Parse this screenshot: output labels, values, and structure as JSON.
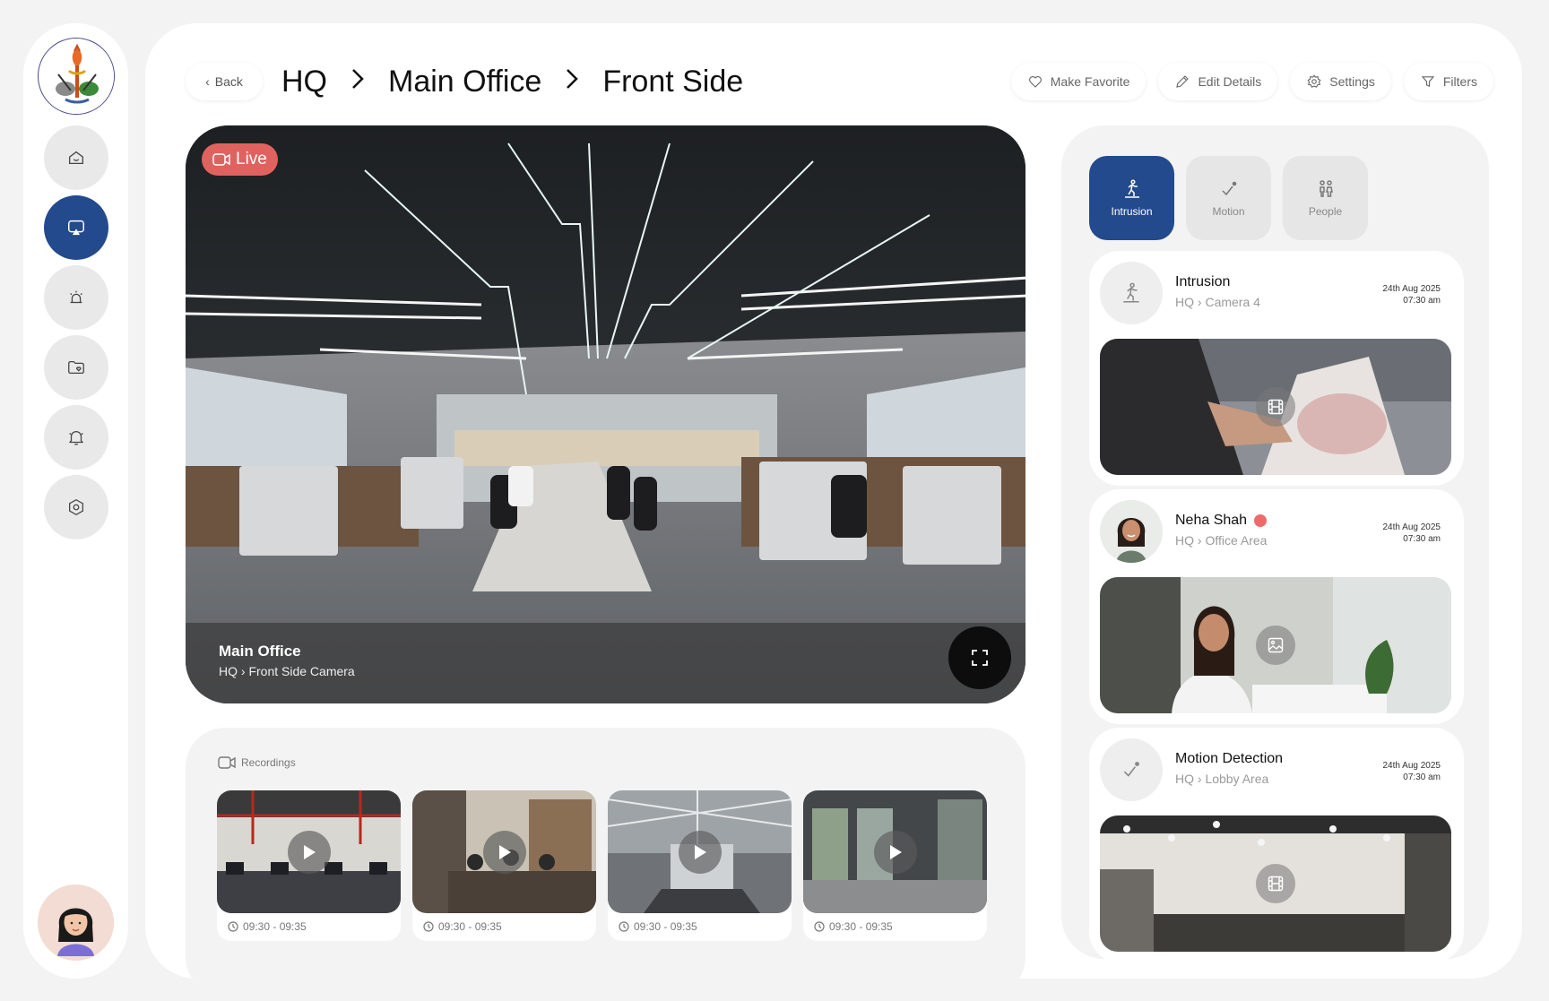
{
  "sidebar": {
    "logo_name": "organization-emblem",
    "nav": [
      {
        "icon": "home-icon",
        "active": false
      },
      {
        "icon": "camera-feed-icon",
        "active": true
      },
      {
        "icon": "alarm-icon",
        "active": false
      },
      {
        "icon": "folder-heart-icon",
        "active": false
      },
      {
        "icon": "bell-icon",
        "active": false
      },
      {
        "icon": "settings-hex-icon",
        "active": false
      }
    ],
    "user_avatar": "user-avatar"
  },
  "header": {
    "back_label": "Back",
    "breadcrumb": [
      "HQ",
      "Main Office",
      "Front Side"
    ],
    "separator": ">",
    "actions": [
      {
        "label": "Make Favorite",
        "icon": "heart-icon"
      },
      {
        "label": "Edit Details",
        "icon": "pencil-icon"
      },
      {
        "label": "Settings",
        "icon": "gear-icon"
      },
      {
        "label": "Filters",
        "icon": "filter-icon"
      }
    ]
  },
  "live_feed": {
    "badge": "Live",
    "title": "Main Office",
    "location": "HQ",
    "camera": "Front Side Camera",
    "sep": ">"
  },
  "recordings": {
    "heading": "Recordings",
    "items": [
      {
        "time": "09:30 - 09:35"
      },
      {
        "time": "09:30 - 09:35"
      },
      {
        "time": "09:30 - 09:35"
      },
      {
        "time": "09:30 - 09:35"
      }
    ]
  },
  "events": {
    "filters": [
      {
        "label": "Intrusion",
        "icon": "intrusion-icon",
        "active": true
      },
      {
        "label": "Motion",
        "icon": "motion-icon",
        "active": false
      },
      {
        "label": "People",
        "icon": "people-icon",
        "active": false
      }
    ],
    "cards": [
      {
        "title": "Intrusion",
        "location": "HQ",
        "area": "Camera 4",
        "date": "24th Aug 2025",
        "time": "07:30 am",
        "media": "video-icon"
      },
      {
        "title": "Neha Shah",
        "location": "HQ",
        "area": "Office Area",
        "date": "24th Aug 2025",
        "time": "07:30 am",
        "media": "image-icon"
      },
      {
        "title": "Motion Detection",
        "location": "HQ",
        "area": "Lobby Area",
        "date": "24th Aug 2025",
        "time": "07:30 am",
        "media": "video-icon"
      }
    ],
    "sep": ">"
  },
  "colors": {
    "primary": "#234a8c",
    "live_badge": "#e0625f",
    "alert_dot": "#ef6b6b",
    "background": "#f3f3f4"
  }
}
